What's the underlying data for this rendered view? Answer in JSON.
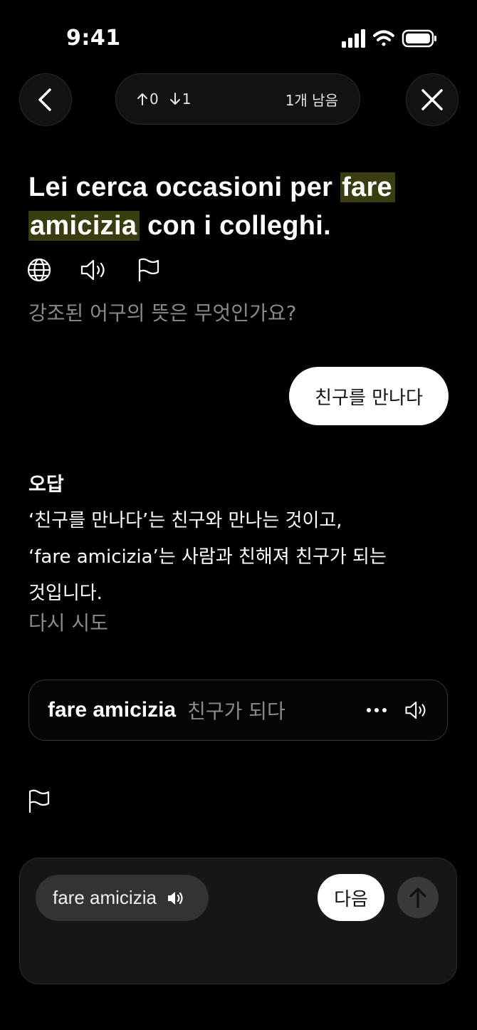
{
  "status_bar": {
    "time": "9:41"
  },
  "header": {
    "up_count": "0",
    "down_count": "1",
    "remaining": "1개 남음"
  },
  "sentence": {
    "before": "Lei cerca occasioni per ",
    "highlight_1": "fare",
    "highlight_2": "amicizia",
    "after": " con i colleghi."
  },
  "question": "강조된 어구의 뜻은 무엇인가요?",
  "answer": "친구를 만나다",
  "feedback": {
    "title": "오답",
    "line_1": "‘친구를 만나다’는 친구와 만나는 것이고,",
    "line_2": "‘fare amicizia’는 사람과 친해져 친구가 되는",
    "line_3": "것입니다.",
    "retry": "다시 시도"
  },
  "term": {
    "word": "fare amicizia",
    "meaning": "친구가 되다"
  },
  "composer": {
    "chip_label": "fare amicizia",
    "next_label": "다음"
  },
  "colors": {
    "highlight": "#3a3d0f",
    "background": "#000000",
    "muted": "#8a8a8a"
  }
}
